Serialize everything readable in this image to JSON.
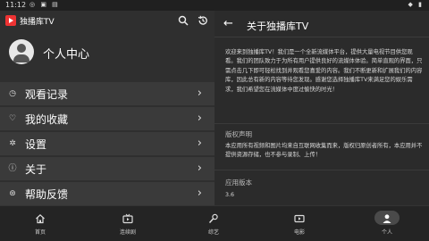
{
  "status_bar": {
    "time": "11:12"
  },
  "left_panel": {
    "app_title": "独播库TV",
    "profile_label": "个人中心",
    "menu": [
      {
        "label": "观看记录",
        "icon": "history-icon"
      },
      {
        "label": "我的收藏",
        "icon": "heart-icon"
      },
      {
        "label": "设置",
        "icon": "gear-icon"
      },
      {
        "label": "关于",
        "icon": "info-icon"
      },
      {
        "label": "帮助反馈",
        "icon": "help-icon"
      }
    ]
  },
  "right_panel": {
    "title": "关于独播库TV",
    "about_text": "欢迎来到独播库TV！我们是一个全新流媒体平台，提供大量电视节目供您观看。我们的团队致力于为所有用户提供良好的流媒体体验。简单直观的界面，只需点击几下即可轻松找到并观看您喜爱的内容。我们不断更新和扩展我们的内容库，因此总有新的内容等待您发现。感谢您选择独播库TV来满足您的娱乐需求，我们希望您在流媒体中度过愉快的时光！",
    "copyright_label": "版权声明",
    "copyright_text": "本应用所有视频和图片均来自互联网收集而来，版权归原创者所有，本应用并不提供资源存储，也不参与录制、上传！",
    "version_label": "应用版本",
    "version_value": "3.6"
  },
  "bottom_nav": [
    {
      "label": "首页",
      "icon": "home-icon"
    },
    {
      "label": "连续剧",
      "icon": "tv-icon"
    },
    {
      "label": "综艺",
      "icon": "mic-icon"
    },
    {
      "label": "电影",
      "icon": "film-icon"
    },
    {
      "label": "个人",
      "icon": "person-icon",
      "active": true
    }
  ]
}
